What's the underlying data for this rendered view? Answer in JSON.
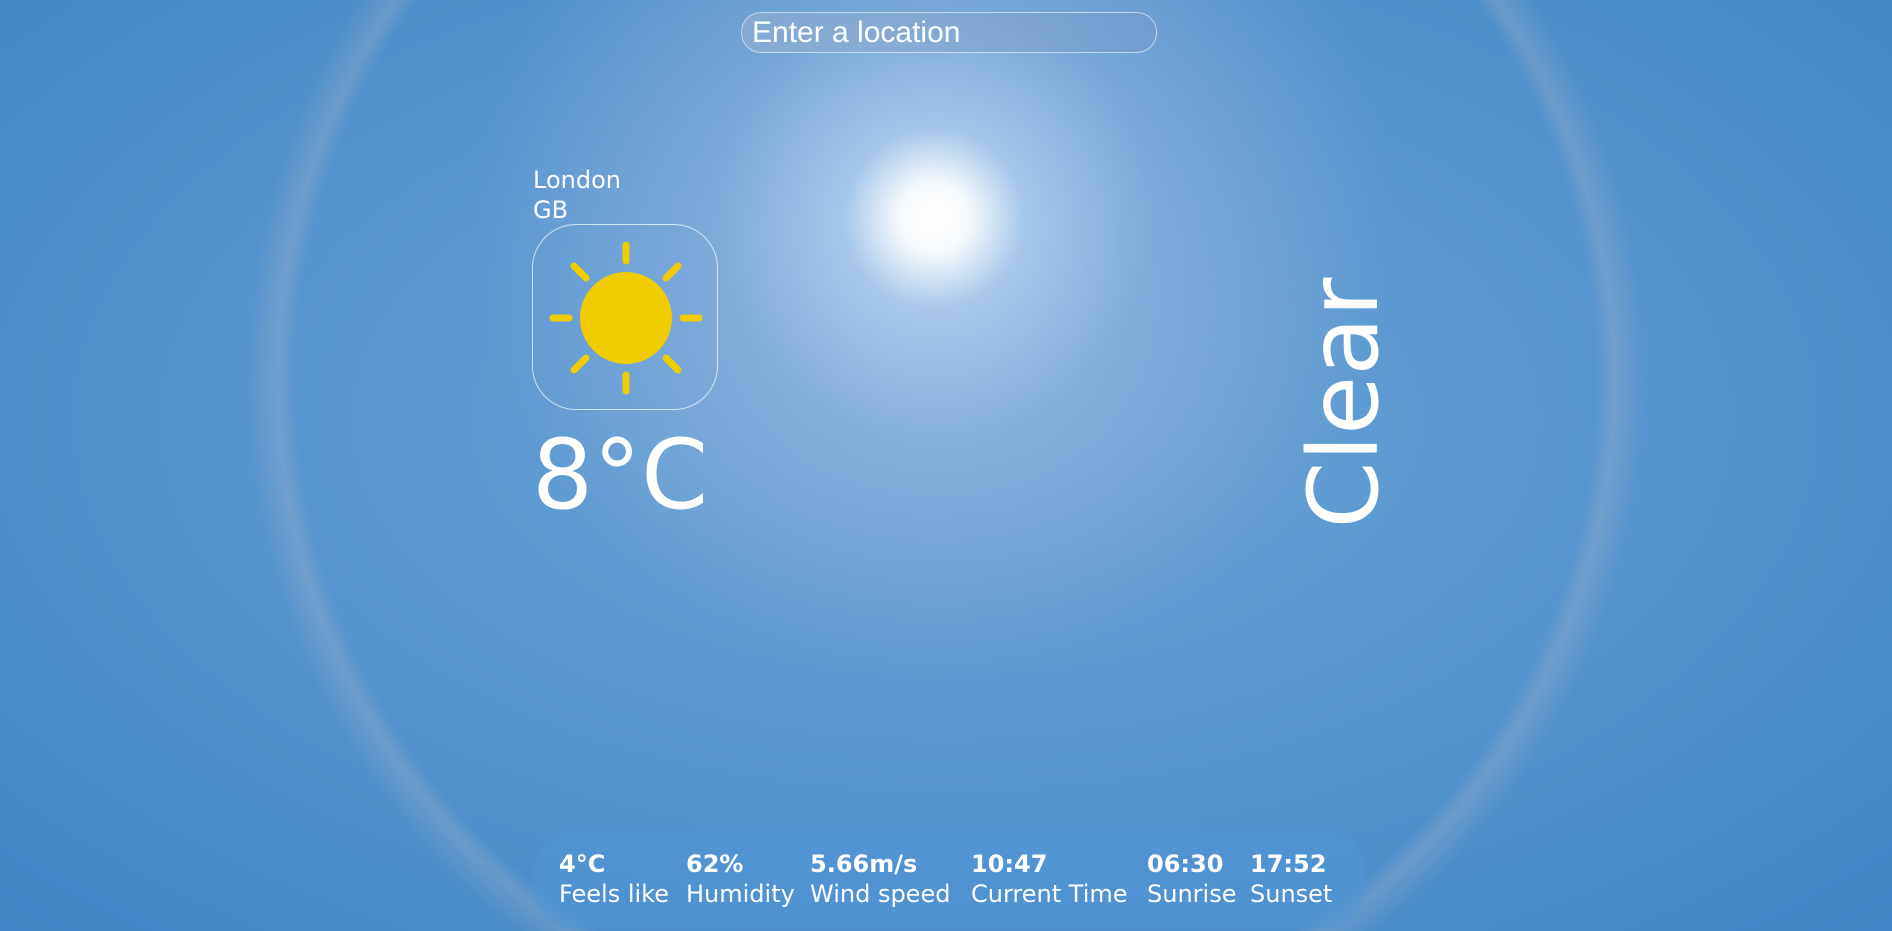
{
  "search": {
    "placeholder": "Enter a location"
  },
  "location": {
    "city": "London",
    "country": "GB"
  },
  "weather": {
    "icon": "sun-icon",
    "icon_color": "#f0cc00",
    "temperature": "8°C",
    "description": "Clear"
  },
  "details": [
    {
      "value": "4°C",
      "label": "Feels like"
    },
    {
      "value": "62%",
      "label": "Humidity"
    },
    {
      "value": "5.66m/s",
      "label": "Wind speed"
    },
    {
      "value": "10:47",
      "label": "Current Time"
    },
    {
      "value": "06:30",
      "label": "Sunrise"
    },
    {
      "value": "17:52",
      "label": "Sunset"
    }
  ]
}
